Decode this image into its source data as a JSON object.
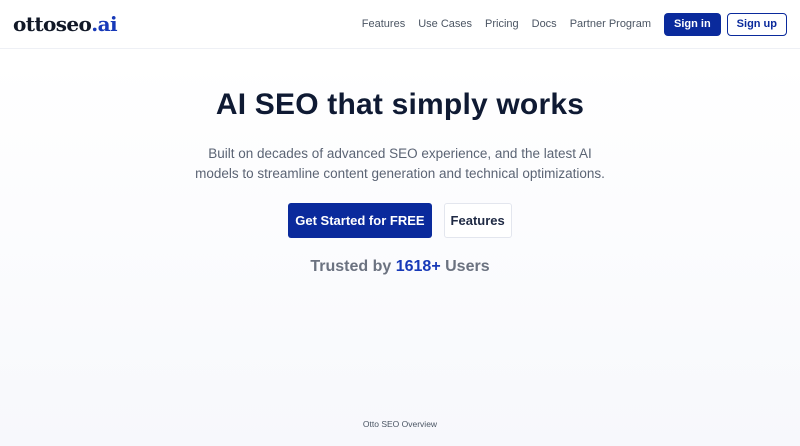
{
  "brand": {
    "logo_main": "ottoseo",
    "logo_accent": ".ai",
    "accent_color": "#1739b8",
    "primary_color": "#0a2a9c"
  },
  "nav": {
    "links": [
      "Features",
      "Use Cases",
      "Pricing",
      "Docs",
      "Partner Program"
    ],
    "signin_label": "Sign in",
    "signup_label": "Sign up"
  },
  "hero": {
    "title": "AI SEO that simply works",
    "subtitle": "Built on decades of advanced SEO experience, and the latest AI models to streamline content generation and technical optimizations.",
    "primary_cta": "Get Started for FREE",
    "secondary_cta": "Features",
    "trusted_prefix": "Trusted by",
    "trusted_count": "1618+",
    "trusted_suffix": "Users"
  },
  "footer": {
    "overview_label": "Otto SEO Overview"
  }
}
